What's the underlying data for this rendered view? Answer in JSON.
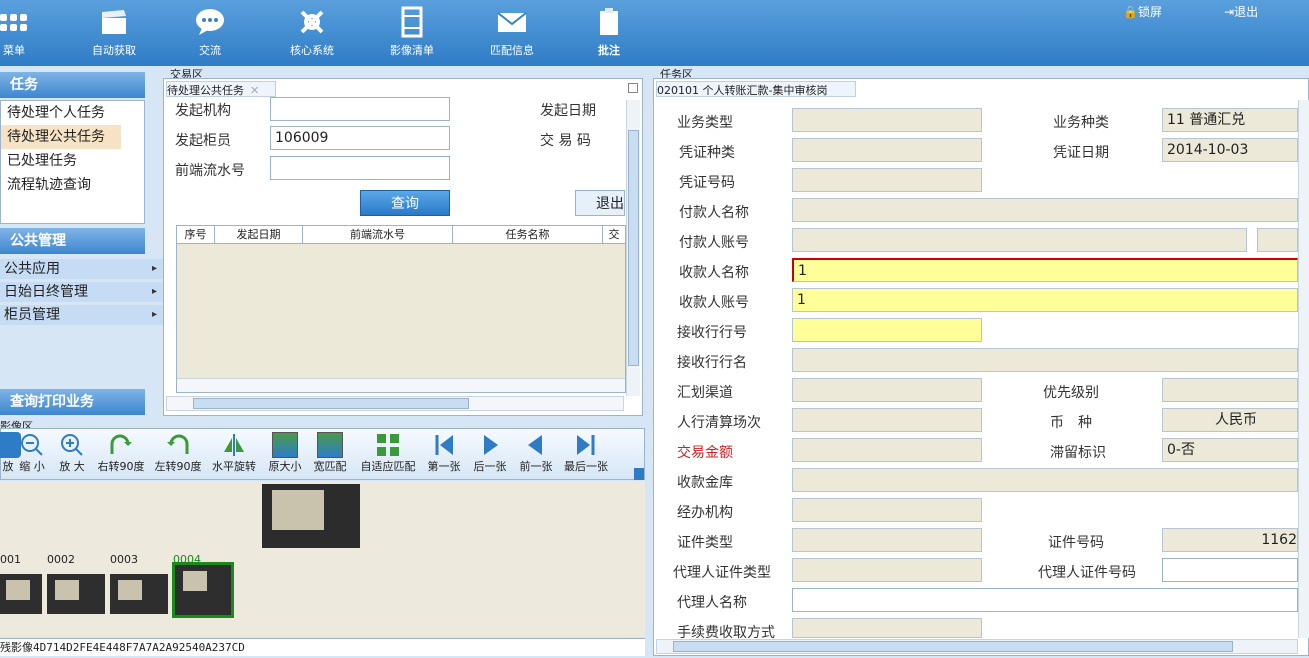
{
  "toolbar": {
    "items": [
      "菜单",
      "自动获取",
      "交流",
      "核心系统",
      "影像清单",
      "匹配信息",
      "批注"
    ],
    "lock": "锁屏",
    "exit": "退出"
  },
  "left": {
    "task_head": "任务",
    "tasks": [
      "待处理个人任务",
      "待处理公共任务",
      "已处理任务",
      "流程轨迹查询"
    ],
    "public_head": "公共管理",
    "public_items": [
      "公共应用",
      "日始日终管理",
      "柜员管理"
    ],
    "print_head": "查询打印业务"
  },
  "mid": {
    "region": "交易区",
    "tab": "待处理公共任务",
    "org_label": "发起机构",
    "date_label": "发起日期",
    "teller_label": "发起柜员",
    "teller_value": "106009",
    "code_label": "交 易 码",
    "flow_label": "前端流水号",
    "query": "查询",
    "exit": "退出",
    "cols": [
      "序号",
      "发起日期",
      "前端流水号",
      "任务名称",
      "交"
    ]
  },
  "image": {
    "region": "影像区",
    "tools": [
      "放",
      "缩 小",
      "放 大",
      "右转90度",
      "左转90度",
      "水平旋转",
      "原大小",
      "宽匹配",
      "自适应匹配",
      "第一张",
      "后一张",
      "前一张",
      "最后一张"
    ],
    "thumbs": [
      "001",
      "0002",
      "0003",
      "0004"
    ],
    "status": "残影像4D714D2FE4E448F7A7A2A92540A237CD"
  },
  "right": {
    "region": "任务区",
    "tab": "020101 个人转账汇款-集中审核岗",
    "fields": {
      "biz_type": "业务类型",
      "biz_kind": "业务种类",
      "biz_kind_val": "11 普通汇兑",
      "voucher_kind": "凭证种类",
      "voucher_date": "凭证日期",
      "voucher_date_val": "2014-10-03",
      "voucher_no": "凭证号码",
      "payer_name": "付款人名称",
      "payer_acct": "付款人账号",
      "payee_name": "收款人名称",
      "payee_name_val": "1",
      "payee_acct": "收款人账号",
      "payee_acct_val": "1",
      "recv_bank_no": "接收行行号",
      "recv_bank_name": "接收行行名",
      "channel": "汇划渠道",
      "priority": "优先级别",
      "clearing": "人行清算场次",
      "currency": "币　种",
      "currency_val": "人民币",
      "amount": "交易金额",
      "retention": "滞留标识",
      "retention_val": "0-否",
      "vault": "收款金库",
      "org": "经办机构",
      "id_type": "证件类型",
      "id_no": "证件号码",
      "id_no_val": "1162",
      "agent_id_type": "代理人证件类型",
      "agent_id_no": "代理人证件号码",
      "agent_name": "代理人名称",
      "fee_mode": "手续费收取方式"
    }
  }
}
